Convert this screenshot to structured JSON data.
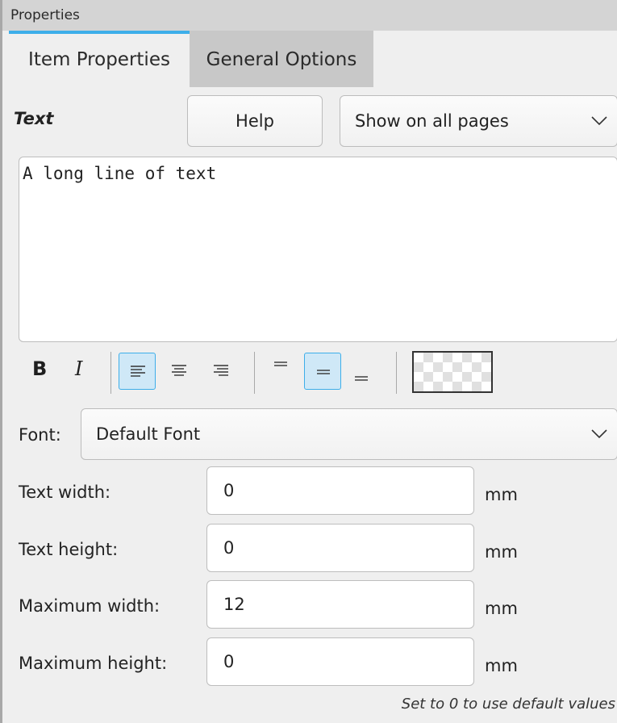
{
  "panel": {
    "title": "Properties"
  },
  "tabs": [
    {
      "label": "Item Properties",
      "active": true
    },
    {
      "label": "General Options",
      "active": false
    }
  ],
  "text_section": {
    "label": "Text",
    "help_label": "Help",
    "pages_select": "Show on all pages",
    "content": "A long line of text"
  },
  "toolbar": {
    "bold_label": "B",
    "italic_label": "I",
    "items": [
      {
        "name": "bold-button",
        "icon": "bold-icon",
        "active": false
      },
      {
        "name": "italic-button",
        "icon": "italic-icon",
        "active": false
      },
      {
        "name": "align-left-button",
        "icon": "align-left-icon",
        "active": true
      },
      {
        "name": "align-center-button",
        "icon": "align-center-icon",
        "active": false
      },
      {
        "name": "align-right-button",
        "icon": "align-right-icon",
        "active": false
      },
      {
        "name": "valign-top-button",
        "icon": "valign-top-icon",
        "active": false
      },
      {
        "name": "valign-middle-button",
        "icon": "valign-middle-icon",
        "active": true
      },
      {
        "name": "valign-bottom-button",
        "icon": "valign-bottom-icon",
        "active": false
      },
      {
        "name": "color-swatch",
        "icon": "transparent-swatch",
        "active": false
      }
    ]
  },
  "font": {
    "label": "Font:",
    "value": "Default Font"
  },
  "fields": [
    {
      "label": "Text width:",
      "value": "0",
      "unit": "mm"
    },
    {
      "label": "Text height:",
      "value": "0",
      "unit": "mm"
    },
    {
      "label": "Maximum width:",
      "value": "12",
      "unit": "mm"
    },
    {
      "label": "Maximum height:",
      "value": "0",
      "unit": "mm"
    }
  ],
  "hint": "Set to 0 to use default values",
  "colors": {
    "accent": "#3daee9",
    "active_tool_bg": "#cfe8f7"
  }
}
